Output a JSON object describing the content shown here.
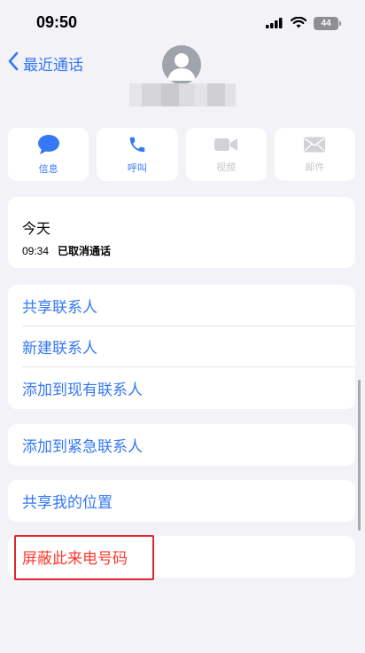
{
  "status_bar": {
    "time": "09:50",
    "battery": "44"
  },
  "nav": {
    "back_label": "最近通话"
  },
  "actions": [
    {
      "label": "信息",
      "icon": "message-icon",
      "enabled": true
    },
    {
      "label": "呼叫",
      "icon": "phone-icon",
      "enabled": true
    },
    {
      "label": "视频",
      "icon": "video-icon",
      "enabled": false
    },
    {
      "label": "邮件",
      "icon": "mail-icon",
      "enabled": false
    }
  ],
  "call_history": {
    "date": "今天",
    "time": "09:34",
    "status": "已取消通话"
  },
  "menu": {
    "share_contact": "共享联系人",
    "new_contact": "新建联系人",
    "add_existing": "添加到现有联系人",
    "add_emergency": "添加到紧急联系人",
    "share_location": "共享我的位置",
    "block_caller": "屏蔽此来电号码"
  },
  "colors": {
    "accent": "#3478f6",
    "danger": "#ff3b30",
    "background": "#f2f2f7",
    "highlight": "#e0262b"
  }
}
